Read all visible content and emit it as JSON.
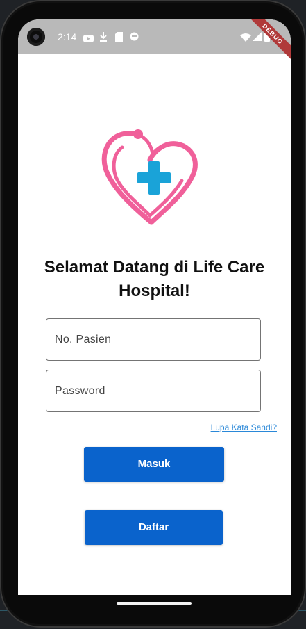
{
  "status_bar": {
    "time": "2:14",
    "notification_icons": [
      "youtube-icon",
      "download-icon",
      "sim-card-icon",
      "face-icon"
    ],
    "system_icons": [
      "wifi-icon",
      "signal-icon",
      "battery-icon"
    ],
    "debug_label": "DEBUG"
  },
  "logo": {
    "icon": "heart-stethoscope-medical-cross",
    "heart_color": "#f0609a",
    "cross_color": "#1aa3d8"
  },
  "login": {
    "welcome_text": "Selamat Datang di Life Care Hospital!",
    "patient_number_placeholder": "No. Pasien",
    "password_placeholder": "Password",
    "forgot_password_link": "Lupa Kata Sandi?",
    "login_button": "Masuk",
    "register_button": "Daftar"
  },
  "colors": {
    "primary_button": "#0a63cc",
    "link": "#2a88d8",
    "status_bar": "#b9b9b9"
  }
}
